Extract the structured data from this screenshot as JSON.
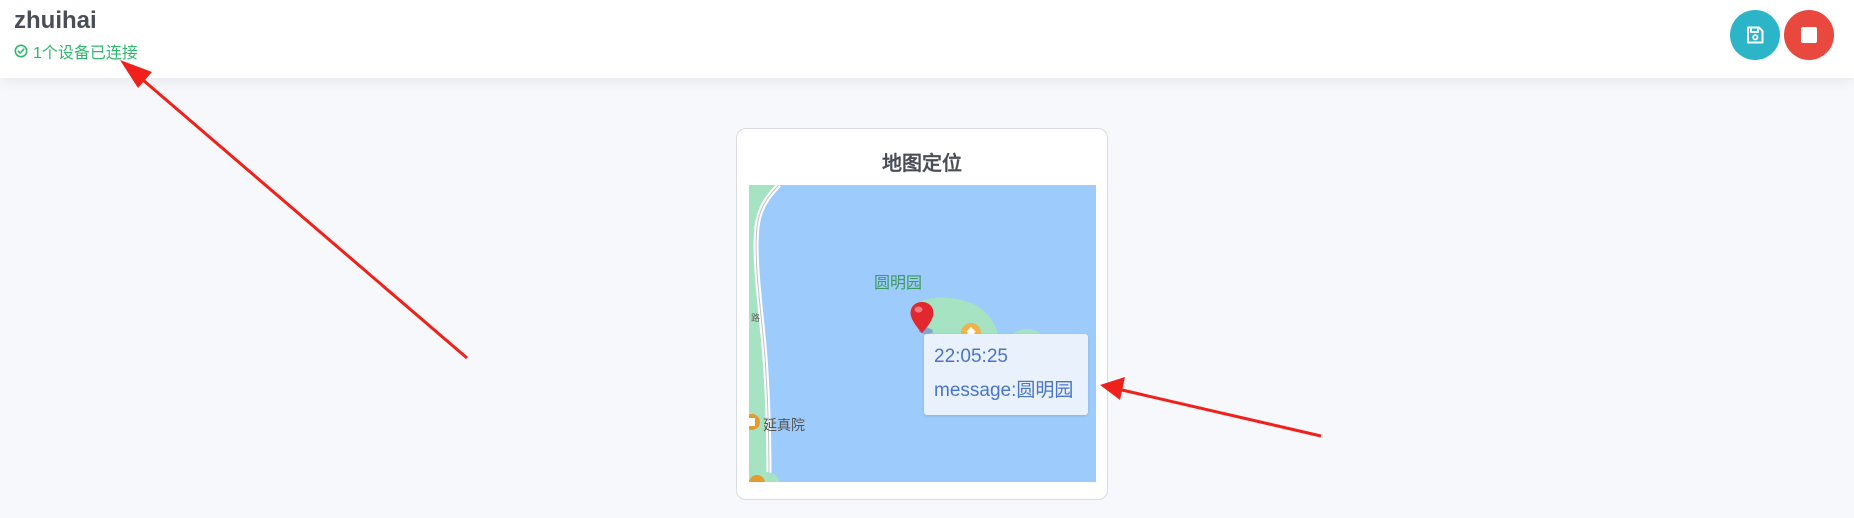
{
  "header": {
    "title": "zhuihai",
    "status_text": "1个设备已连接",
    "status_icon": "check-circle-icon",
    "save_icon": "floppy-disk-icon",
    "stop_icon": "stop-square-icon"
  },
  "card": {
    "title": "地图定位"
  },
  "map": {
    "labels": {
      "yuanmingyuan": "圆明园",
      "yanzhenyuan": "延真院",
      "road": "路"
    },
    "marker_icon": "map-pin-icon",
    "popup": {
      "time": "22:05:25",
      "message": "message:圆明园"
    }
  },
  "colors": {
    "status_green": "#2fb86b",
    "save_button": "#2cb5c9",
    "stop_button": "#e8483e",
    "water": "#9dcbfb",
    "popup_text": "#4a74c9",
    "annotation_arrow": "#f0201a"
  }
}
